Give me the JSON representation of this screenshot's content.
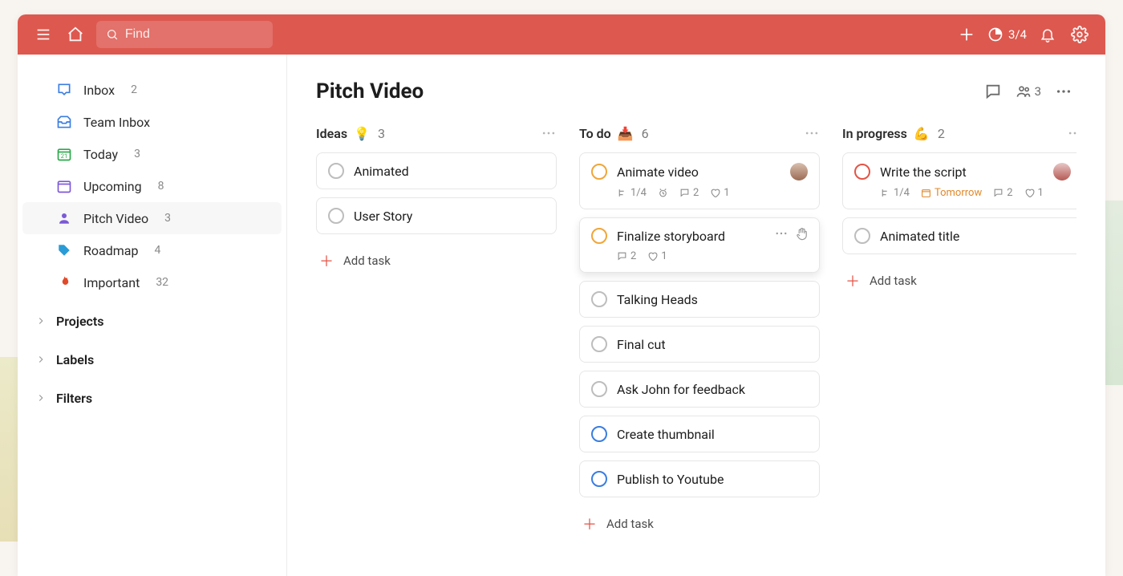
{
  "topbar": {
    "search_placeholder": "Find",
    "usage_count": "3/4"
  },
  "sidebar": {
    "items": [
      {
        "label": "Inbox",
        "count": "2"
      },
      {
        "label": "Team Inbox",
        "count": ""
      },
      {
        "label": "Today",
        "count": "3"
      },
      {
        "label": "Upcoming",
        "count": "8"
      },
      {
        "label": "Pitch Video",
        "count": "3"
      },
      {
        "label": "Roadmap",
        "count": "4"
      },
      {
        "label": "Important",
        "count": "32"
      }
    ],
    "groups": [
      {
        "label": "Projects"
      },
      {
        "label": "Labels"
      },
      {
        "label": "Filters"
      }
    ]
  },
  "main": {
    "title": "Pitch Video",
    "members_count": "3"
  },
  "columns": [
    {
      "title": "Ideas",
      "emoji": "💡",
      "count": "3",
      "add_label": "Add task",
      "cards": [
        {
          "title": "Animated",
          "check": "default"
        },
        {
          "title": "User Story",
          "check": "default"
        }
      ]
    },
    {
      "title": "To do",
      "emoji": "📥",
      "count": "6",
      "add_label": "Add task",
      "cards": [
        {
          "title": "Animate video",
          "check": "orange",
          "avatar": true,
          "meta": {
            "subtasks": "1/4",
            "reminder": true,
            "comments": "2",
            "likes": "1"
          }
        },
        {
          "title": "Finalize storyboard",
          "check": "orange",
          "hovered": true,
          "meta": {
            "comments": "2",
            "likes": "1"
          }
        },
        {
          "title": "Talking Heads",
          "check": "default"
        },
        {
          "title": "Final cut",
          "check": "default"
        },
        {
          "title": "Ask John for feedback",
          "check": "default"
        },
        {
          "title": "Create thumbnail",
          "check": "blue"
        },
        {
          "title": "Publish to Youtube",
          "check": "blue"
        }
      ]
    },
    {
      "title": "In progress",
      "emoji": "💪",
      "count": "2",
      "add_label": "Add task",
      "cards": [
        {
          "title": "Write the script",
          "check": "red",
          "avatar": "alt",
          "meta": {
            "subtasks": "1/4",
            "due": "Tomorrow",
            "comments": "2",
            "likes": "1"
          }
        },
        {
          "title": "Animated title",
          "check": "default"
        }
      ]
    }
  ]
}
